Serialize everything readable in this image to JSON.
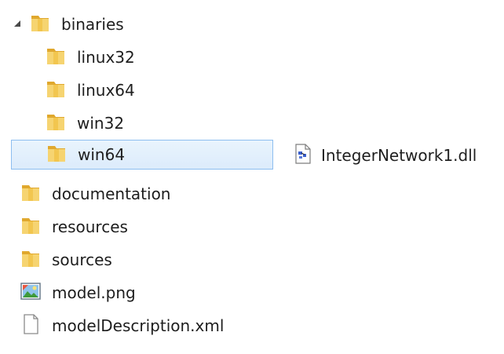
{
  "tree": {
    "items": [
      {
        "label": "binaries",
        "icon": "folder-icon",
        "expanded": true
      },
      {
        "label": "linux32",
        "icon": "folder-icon"
      },
      {
        "label": "linux64",
        "icon": "folder-icon"
      },
      {
        "label": "win32",
        "icon": "folder-icon"
      },
      {
        "label": "win64",
        "icon": "folder-icon",
        "selected": true
      },
      {
        "label": "documentation",
        "icon": "folder-icon"
      },
      {
        "label": "resources",
        "icon": "folder-icon"
      },
      {
        "label": "sources",
        "icon": "folder-icon"
      },
      {
        "label": "model.png",
        "icon": "image-file-icon"
      },
      {
        "label": "modelDescription.xml",
        "icon": "document-file-icon"
      }
    ]
  },
  "files": {
    "items": [
      {
        "label": "IntegerNetwork1.dll",
        "icon": "dll-file-icon"
      }
    ]
  },
  "colors": {
    "selection_fill": "#dcebfb",
    "selection_border": "#8dbef0",
    "folder": "#f2c94c"
  }
}
